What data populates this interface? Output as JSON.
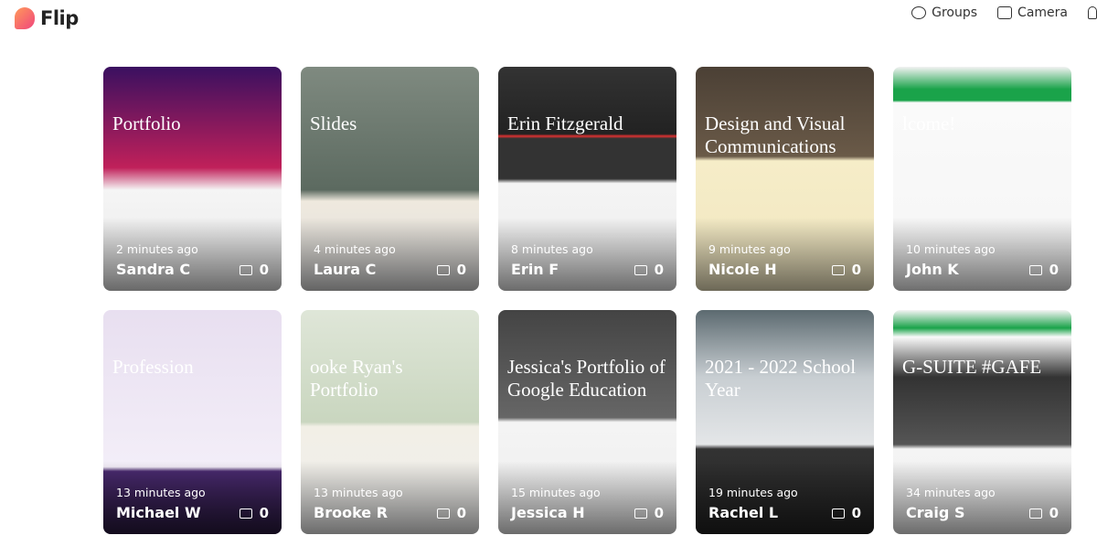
{
  "app": {
    "name": "Flip"
  },
  "nav": {
    "groups": "Groups",
    "camera": "Camera"
  },
  "colors": {
    "brand_start": "#ff9a5a",
    "brand_end": "#f0457c"
  },
  "cards": [
    {
      "title": "Portfolio",
      "time": "2 minutes ago",
      "name": "Sandra C",
      "comments": "0",
      "bg": "linear-gradient(#3a1060 0%,#c0205a 45%,#f5f5f5 55%,#e8e8e8 100%)"
    },
    {
      "title": "Slides",
      "time": "4 minutes ago",
      "name": "Laura C",
      "comments": "0",
      "bg": "linear-gradient(#7f8a80 0%,#5c6a60 55%,#efe9de 60%,#ddd 100%)"
    },
    {
      "title": "Erin Fitzgerald",
      "time": "8 minutes ago",
      "name": "Erin F",
      "comments": "0",
      "bg": "linear-gradient(#333 0%,#222 30%,#e03030 31%,#333 32%,#333 50%,#f4f4f4 52%,#eee 100%)"
    },
    {
      "title": "Design and Visual Communications",
      "time": "9 minutes ago",
      "name": "Nicole H",
      "comments": "0",
      "bg": "linear-gradient(#4b4035 0%,#6a5a48 40%,#f6edc8 42%,#f0e6c0 100%)"
    },
    {
      "title": "lcome!",
      "time": "10 minutes ago",
      "name": "John K",
      "comments": "0",
      "bg": "linear-gradient(#f2f2f2 0%,#1aa34a 10%,#1aa34a 15%,#fafafa 16%,#f5f5f5 100%)"
    },
    {
      "title": "Profession",
      "time": "13 minutes ago",
      "name": "Michael W",
      "comments": "0",
      "bg": "linear-gradient(#e8dff0 0%,#f3eef8 70%,#4a2a70 72%,#2a1a40 100%)"
    },
    {
      "title": "ooke Ryan's Portfolio",
      "time": "13 minutes ago",
      "name": "Brooke R",
      "comments": "0",
      "bg": "linear-gradient(#dfe6d8 0%,#c9d6bf 50%,#f2efe6 52%,#eee 100%)"
    },
    {
      "title": "Jessica's Portfolio of Google Education",
      "time": "15 minutes ago",
      "name": "Jessica H",
      "comments": "0",
      "bg": "linear-gradient(#444 0%,#666 48%,#f4f4f4 50%,#eee 100%)"
    },
    {
      "title": "2021 - 2022 School Year",
      "time": "19 minutes ago",
      "name": "Rachel L",
      "comments": "0",
      "bg": "linear-gradient(#5c6a70 0%,#c8ced2 30%,#e4e6e8 60%,#333 62%,#222 100%)"
    },
    {
      "title": "G-SUITE #GAFE",
      "time": "34 minutes ago",
      "name": "Craig S",
      "comments": "0",
      "bg": "linear-gradient(#f4f4f4 0%,#1aa34a 8%,#fafafa 12%,#333 30%,#555 60%,#f4f4f4 62%,#eee 100%)"
    }
  ]
}
